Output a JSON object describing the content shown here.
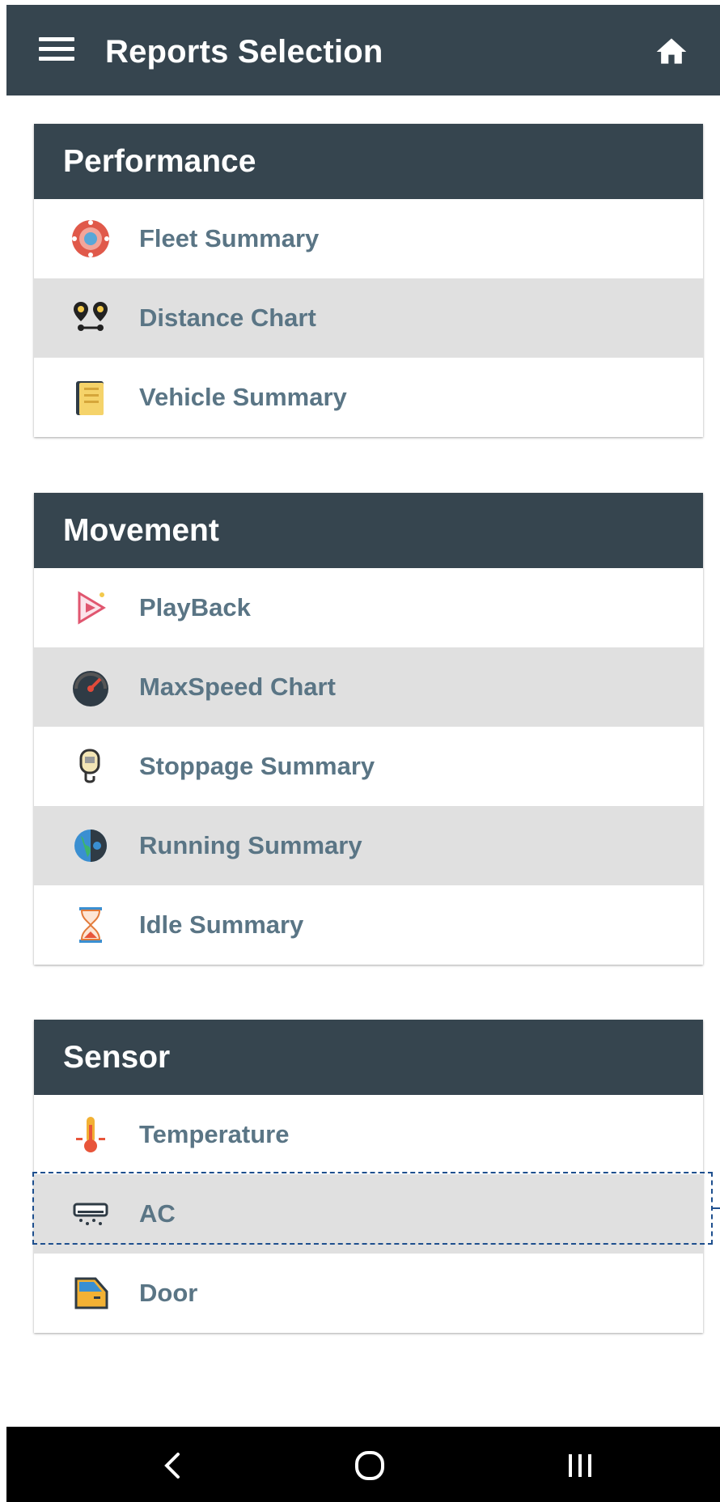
{
  "appbar": {
    "title": "Reports Selection",
    "menu_icon": "menu-icon",
    "home_icon": "home-icon"
  },
  "sections": {
    "performance": {
      "title": "Performance",
      "items": [
        {
          "label": "Fleet Summary",
          "icon": "fleet-icon"
        },
        {
          "label": "Distance Chart",
          "icon": "distance-pins-icon"
        },
        {
          "label": "Vehicle Summary",
          "icon": "notebook-icon"
        }
      ]
    },
    "movement": {
      "title": "Movement",
      "items": [
        {
          "label": "PlayBack",
          "icon": "play-icon"
        },
        {
          "label": "MaxSpeed Chart",
          "icon": "speedometer-icon"
        },
        {
          "label": "Stoppage Summary",
          "icon": "stopwatch-icon"
        },
        {
          "label": "Running Summary",
          "icon": "globe-gear-icon"
        },
        {
          "label": "Idle Summary",
          "icon": "hourglass-icon"
        }
      ]
    },
    "sensor": {
      "title": "Sensor",
      "items": [
        {
          "label": "Temperature",
          "icon": "thermometer-icon"
        },
        {
          "label": "AC",
          "icon": "ac-icon"
        },
        {
          "label": "Door",
          "icon": "door-icon"
        }
      ]
    }
  },
  "navbar": {
    "back_icon": "back-icon",
    "home_icon": "home-circle-icon",
    "recents_icon": "recents-icon"
  },
  "colors": {
    "header_bg": "#36454f",
    "row_alt": "#e0e0e0",
    "label": "#5a7585",
    "selection": "#1e4f8e"
  }
}
